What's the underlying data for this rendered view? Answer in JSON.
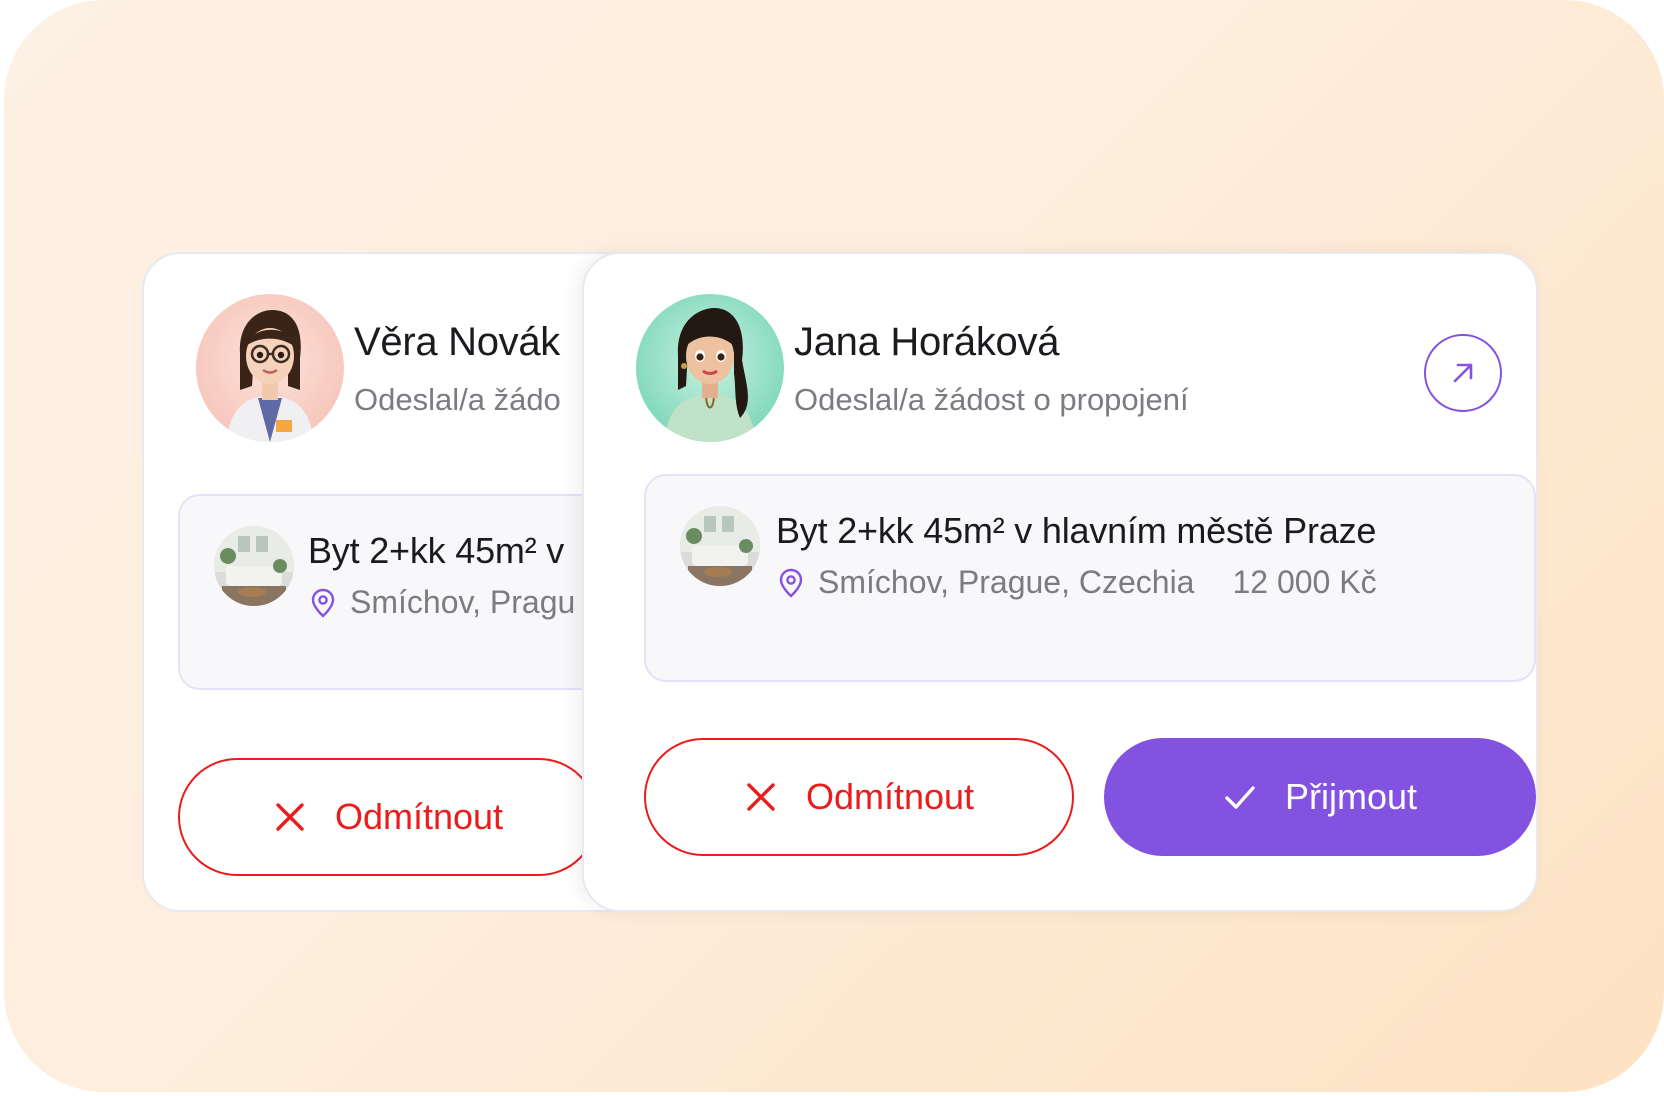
{
  "colors": {
    "accent": "#8452e0",
    "danger": "#ea1c1c",
    "background_from": "#fdf0e4",
    "background_to": "#fde2c2"
  },
  "cards": [
    {
      "name": "Věra Novák",
      "subtitle": "Odeslal/a žádo",
      "listing": {
        "title": "Byt 2+kk 45m² v",
        "location": "Smíchov, Pragu"
      },
      "reject_label": "Odmítnout"
    },
    {
      "name": "Jana Horáková",
      "subtitle": "Odeslal/a žádost o propojení",
      "open_icon": "arrow-up-right-icon",
      "listing": {
        "title": "Byt 2+kk 45m² v hlavním městě Praze",
        "location": "Smíchov, Prague, Czechia",
        "price": "12 000 Kč",
        "location_icon": "map-pin-icon"
      },
      "reject_label": "Odmítnout",
      "reject_icon": "close-icon",
      "accept_label": "Přijmout",
      "accept_icon": "check-icon"
    }
  ]
}
